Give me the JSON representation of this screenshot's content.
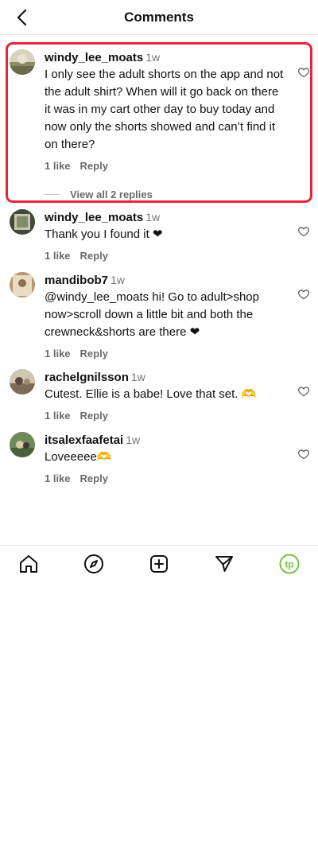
{
  "header": {
    "title": "Comments"
  },
  "comments": [
    {
      "username": "windy_lee_moats",
      "time": "1w",
      "text": "I only see the adult shorts on the app and not the adult shirt? When will it go back on there it was in my cart other day to buy today and now only the shorts showed and can’t find it on there?",
      "likes": "1 like",
      "reply": "Reply",
      "view_replies": "View all 2 replies"
    },
    {
      "username": "windy_lee_moats",
      "time": "1w",
      "text": "Thank you I found it ❤",
      "likes": "1 like",
      "reply": "Reply"
    },
    {
      "username": "mandibob7",
      "time": "1w",
      "text": "@windy_lee_moats hi! Go to adult>shop now>scroll down a little bit and both the crewneck&shorts are there ❤",
      "likes": "1 like",
      "reply": "Reply"
    },
    {
      "username": "rachelgnilsson",
      "time": "1w",
      "text": "Cutest. Ellie is a babe! Love that set. 🫶",
      "likes": "1 like",
      "reply": "Reply"
    },
    {
      "username": "itsalexfaafetai",
      "time": "1w",
      "text": "Loveeeee🫶",
      "likes": "1 like",
      "reply": "Reply"
    }
  ],
  "tabbar": {
    "items": [
      "home-icon",
      "explore-compass-icon",
      "create-plus-icon",
      "share-send-icon",
      "profile-tp-icon"
    ],
    "profile_logo_text": "tp"
  },
  "colors": {
    "highlight": "#e8243a",
    "brand_green": "#7ac143"
  }
}
